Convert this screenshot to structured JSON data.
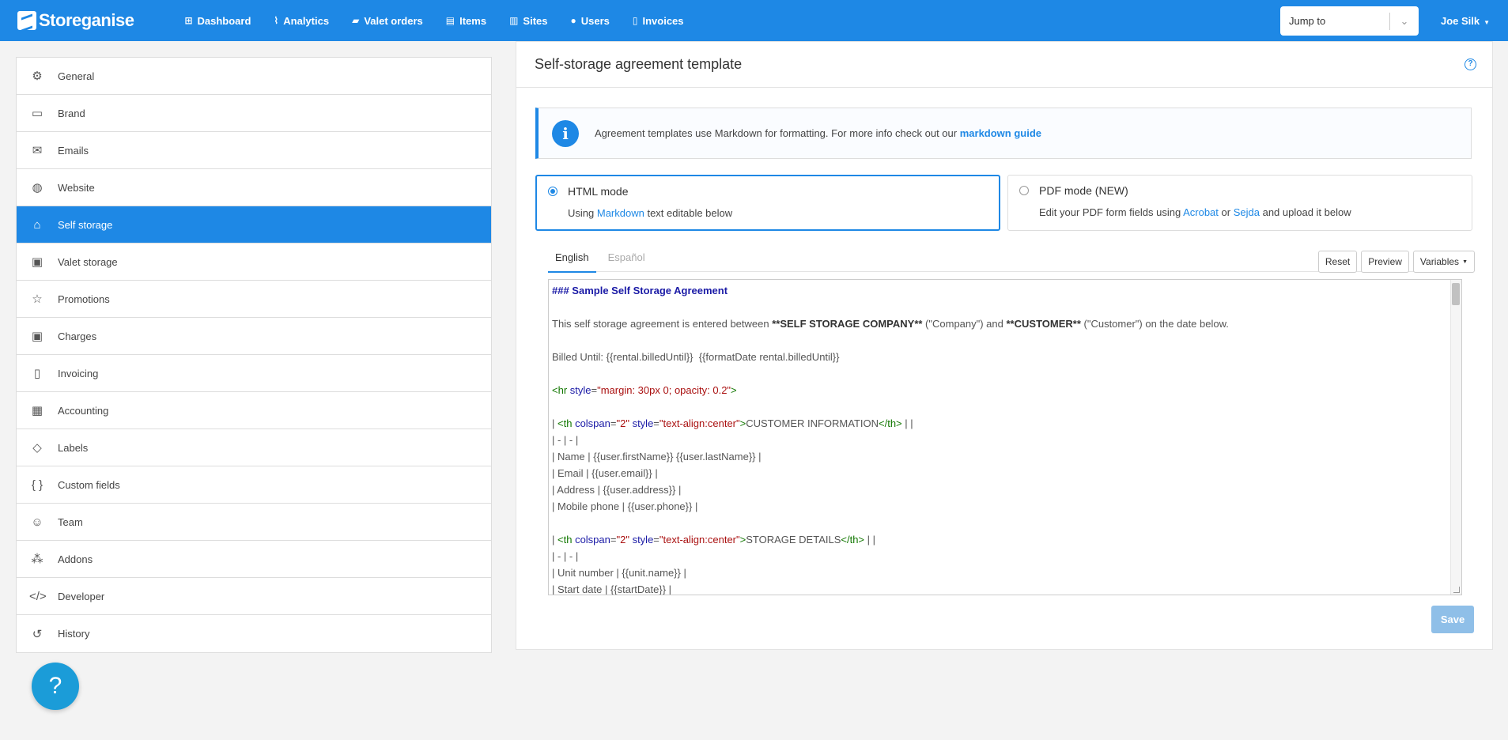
{
  "app": {
    "name": "Storeganise"
  },
  "nav": [
    {
      "label": "Dashboard",
      "icon": "dashboard-icon",
      "glyph": "⊞"
    },
    {
      "label": "Analytics",
      "icon": "chart-icon",
      "glyph": "⌇"
    },
    {
      "label": "Valet orders",
      "icon": "truck-icon",
      "glyph": "▰"
    },
    {
      "label": "Items",
      "icon": "box-icon",
      "glyph": "▤"
    },
    {
      "label": "Sites",
      "icon": "building-icon",
      "glyph": "▥"
    },
    {
      "label": "Users",
      "icon": "user-icon",
      "glyph": "●"
    },
    {
      "label": "Invoices",
      "icon": "invoice-icon",
      "glyph": "▯"
    }
  ],
  "jump": {
    "placeholder": "Jump to"
  },
  "user": {
    "name": "Joe Silk"
  },
  "sidebar": {
    "active": "Self storage",
    "items": [
      {
        "label": "General",
        "icon": "gear-icon",
        "glyph": "⚙"
      },
      {
        "label": "Brand",
        "icon": "image-icon",
        "glyph": "▭"
      },
      {
        "label": "Emails",
        "icon": "envelope-icon",
        "glyph": "✉"
      },
      {
        "label": "Website",
        "icon": "globe-icon",
        "glyph": "◍"
      },
      {
        "label": "Self storage",
        "icon": "warehouse-icon",
        "glyph": "⌂"
      },
      {
        "label": "Valet storage",
        "icon": "archive-icon",
        "glyph": "▣"
      },
      {
        "label": "Promotions",
        "icon": "star-icon",
        "glyph": "☆"
      },
      {
        "label": "Charges",
        "icon": "money-icon",
        "glyph": "▣"
      },
      {
        "label": "Invoicing",
        "icon": "receipt-icon",
        "glyph": "▯"
      },
      {
        "label": "Accounting",
        "icon": "calculator-icon",
        "glyph": "▦"
      },
      {
        "label": "Labels",
        "icon": "tags-icon",
        "glyph": "◇"
      },
      {
        "label": "Custom fields",
        "icon": "braces-icon",
        "glyph": "{ }"
      },
      {
        "label": "Team",
        "icon": "team-icon",
        "glyph": "☺"
      },
      {
        "label": "Addons",
        "icon": "cubes-icon",
        "glyph": "⁂"
      },
      {
        "label": "Developer",
        "icon": "code-icon",
        "glyph": "</>"
      },
      {
        "label": "History",
        "icon": "history-icon",
        "glyph": "↺"
      }
    ]
  },
  "help_bubble": {
    "label": "?"
  },
  "main": {
    "title": "Self-storage agreement template",
    "help": "?",
    "info": {
      "icon": "i",
      "text": "Agreement templates use Markdown for formatting. For more info check out our",
      "link": "markdown guide"
    },
    "modes": [
      {
        "title": "HTML mode",
        "selected": true,
        "desc_before": "Using",
        "desc_link": "Markdown",
        "desc_after": "text editable below"
      },
      {
        "title": "PDF mode (NEW)",
        "selected": false,
        "desc_before": "Edit your PDF form fields using",
        "desc_link": "Acrobat",
        "desc_mid": "or",
        "desc_link2": "Sejda",
        "desc_after": "and upload it below"
      }
    ],
    "tabs": [
      {
        "label": "English",
        "active": true
      },
      {
        "label": "Español",
        "active": false
      }
    ],
    "toolbar": {
      "reset": "Reset",
      "preview": "Preview",
      "variables": "Variables"
    },
    "editor": {
      "lines": [
        [
          [
            "h",
            "### Sample Self Storage Agreement"
          ]
        ],
        [
          [
            "t",
            ""
          ]
        ],
        [
          [
            "t",
            "This self storage agreement is entered between "
          ],
          [
            "b",
            "**SELF STORAGE COMPANY**"
          ],
          [
            "t",
            " (\"Company\") and "
          ],
          [
            "b",
            "**CUSTOMER**"
          ],
          [
            "t",
            " (\"Customer\") on the date below."
          ]
        ],
        [
          [
            "t",
            ""
          ]
        ],
        [
          [
            "t",
            "Billed Until: {{rental.billedUntil}}  {{formatDate rental.billedUntil}}"
          ]
        ],
        [
          [
            "t",
            ""
          ]
        ],
        [
          [
            "tg",
            "<hr"
          ],
          [
            "t",
            " "
          ],
          [
            "at",
            "style"
          ],
          [
            "t",
            "="
          ],
          [
            "st",
            "\"margin: 30px 0; opacity: 0.2\""
          ],
          [
            "tg",
            ">"
          ]
        ],
        [
          [
            "t",
            ""
          ]
        ],
        [
          [
            "t",
            "| "
          ],
          [
            "tg",
            "<th"
          ],
          [
            "t",
            " "
          ],
          [
            "at",
            "colspan"
          ],
          [
            "t",
            "="
          ],
          [
            "st",
            "\"2\""
          ],
          [
            "t",
            " "
          ],
          [
            "at",
            "style"
          ],
          [
            "t",
            "="
          ],
          [
            "st",
            "\"text-align:center\""
          ],
          [
            "tg",
            ">"
          ],
          [
            "t",
            "CUSTOMER INFORMATION"
          ],
          [
            "tg",
            "</th>"
          ],
          [
            "t",
            " | |"
          ]
        ],
        [
          [
            "t",
            "| - | - |"
          ]
        ],
        [
          [
            "t",
            "| Name | {{user.firstName}} {{user.lastName}} |"
          ]
        ],
        [
          [
            "t",
            "| Email | {{user.email}} |"
          ]
        ],
        [
          [
            "t",
            "| Address | {{user.address}} |"
          ]
        ],
        [
          [
            "t",
            "| Mobile phone | {{user.phone}} |"
          ]
        ],
        [
          [
            "t",
            ""
          ]
        ],
        [
          [
            "t",
            "| "
          ],
          [
            "tg",
            "<th"
          ],
          [
            "t",
            " "
          ],
          [
            "at",
            "colspan"
          ],
          [
            "t",
            "="
          ],
          [
            "st",
            "\"2\""
          ],
          [
            "t",
            " "
          ],
          [
            "at",
            "style"
          ],
          [
            "t",
            "="
          ],
          [
            "st",
            "\"text-align:center\""
          ],
          [
            "tg",
            ">"
          ],
          [
            "t",
            "STORAGE DETAILS"
          ],
          [
            "tg",
            "</th>"
          ],
          [
            "t",
            " | |"
          ]
        ],
        [
          [
            "t",
            "| - | - |"
          ]
        ],
        [
          [
            "t",
            "| Unit number | {{unit.name}} |"
          ]
        ],
        [
          [
            "t",
            "| Start date | {{startDate}} |"
          ]
        ]
      ]
    },
    "save": "Save"
  },
  "colors": {
    "primary": "#1e88e5",
    "save_disabled": "#8fbfe8",
    "help_bubble": "#1b9cd8"
  }
}
